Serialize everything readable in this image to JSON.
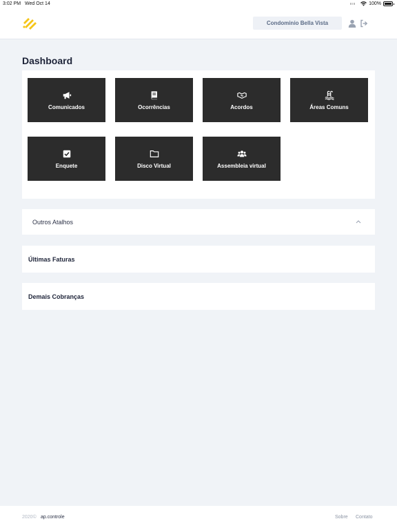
{
  "status_bar": {
    "time": "3:02 PM",
    "date": "Wed Oct 14",
    "battery": "100%"
  },
  "header": {
    "condo_name": "Condominio Bella Vista",
    "brand_color": "#f5c518"
  },
  "main": {
    "title": "Dashboard",
    "tiles": [
      {
        "label": "Comunicados",
        "icon": "megaphone-icon"
      },
      {
        "label": "Ocorrências",
        "icon": "book-icon"
      },
      {
        "label": "Acordos",
        "icon": "handshake-icon"
      },
      {
        "label": "Áreas Comuns",
        "icon": "pool-icon"
      },
      {
        "label": "Enquete",
        "icon": "check-square-icon"
      },
      {
        "label": "Disco Virtual",
        "icon": "folder-icon"
      },
      {
        "label": "Assembleia virtual",
        "icon": "users-icon"
      }
    ],
    "outros_atalhos": "Outros Atalhos",
    "ultimas_faturas": "Últimas Faturas",
    "demais_cobrancas": "Demais Cobranças"
  },
  "footer": {
    "year": "2020©",
    "brand": "ap.controle",
    "sobre": "Sobre",
    "contato": "Contato"
  },
  "colors": {
    "tile_bg": "#2c2c2c",
    "page_bg": "#f0f3f7"
  }
}
